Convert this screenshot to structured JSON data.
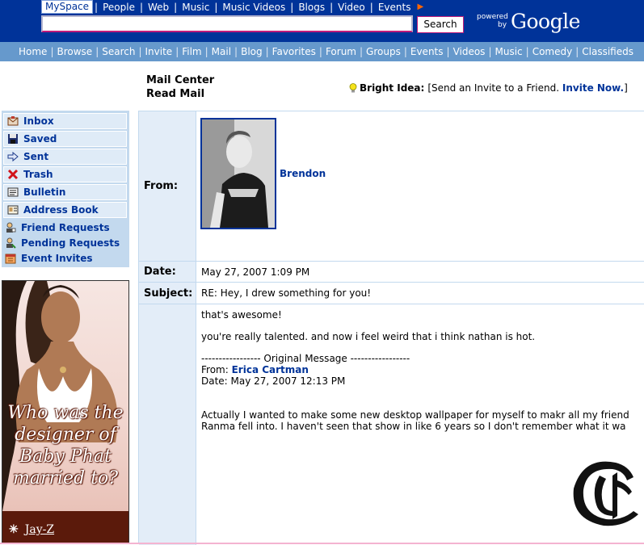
{
  "topbar": {
    "tabs": [
      "MySpace",
      "People",
      "Web",
      "Music",
      "Music Videos",
      "Blogs",
      "Video",
      "Events"
    ],
    "search_value": "",
    "search_button": "Search",
    "powered_by": [
      "powered",
      "by"
    ],
    "google": "Google"
  },
  "nav": [
    "Home",
    "Browse",
    "Search",
    "Invite",
    "Film",
    "Mail",
    "Blog",
    "Favorites",
    "Forum",
    "Groups",
    "Events",
    "Videos",
    "Music",
    "Comedy",
    "Classifieds"
  ],
  "header": {
    "line1": "Mail Center",
    "line2": "Read Mail"
  },
  "bright_idea": {
    "label": "Bright Idea:",
    "text": "[Send an Invite to a Friend.",
    "link": "Invite Now.",
    "close": "]"
  },
  "sidebar": {
    "boxed": [
      {
        "label": "Inbox",
        "icon": "inbox-icon"
      },
      {
        "label": "Saved",
        "icon": "floppy-icon"
      },
      {
        "label": "Sent",
        "icon": "sent-arrow-icon"
      },
      {
        "label": "Trash",
        "icon": "trash-x-icon"
      },
      {
        "label": "Bulletin",
        "icon": "bulletin-icon"
      },
      {
        "label": "Address Book",
        "icon": "address-book-icon"
      }
    ],
    "plain": [
      {
        "label": "Friend Requests",
        "icon": "friend-request-icon"
      },
      {
        "label": "Pending Requests",
        "icon": "pending-request-icon"
      },
      {
        "label": "Event Invites",
        "icon": "calendar-icon"
      }
    ]
  },
  "ad": {
    "question": [
      "Who was the",
      "designer of",
      "Baby Phat",
      "married to?"
    ],
    "answer": "Jay-Z",
    "bullet": "✳"
  },
  "message": {
    "from_label": "From:",
    "sender": "Brendon",
    "date_label": "Date:",
    "date": "May 27, 2007 1:09 PM",
    "subject_label": "Subject:",
    "subject": "RE: Hey, I drew something for you!",
    "body": {
      "line1": "that's awesome!",
      "line2": "you're really talented. and now i feel weird that i think nathan is hot.",
      "orig_header": "----------------- Original Message -----------------",
      "orig_from_label": "From:",
      "orig_from": "Erica Cartman",
      "orig_date": "Date: May 27, 2007 12:13 PM",
      "para1": "Actually I wanted to make some new desktop wallpaper for myself to makr all my friend",
      "para2": "Ranma fell into. I haven't seen that show in like 6 years so I don't remember what it wa"
    }
  },
  "colors": {
    "brand": "#003399",
    "nav": "#6699cc",
    "sidebar": "#c3d9ee"
  }
}
